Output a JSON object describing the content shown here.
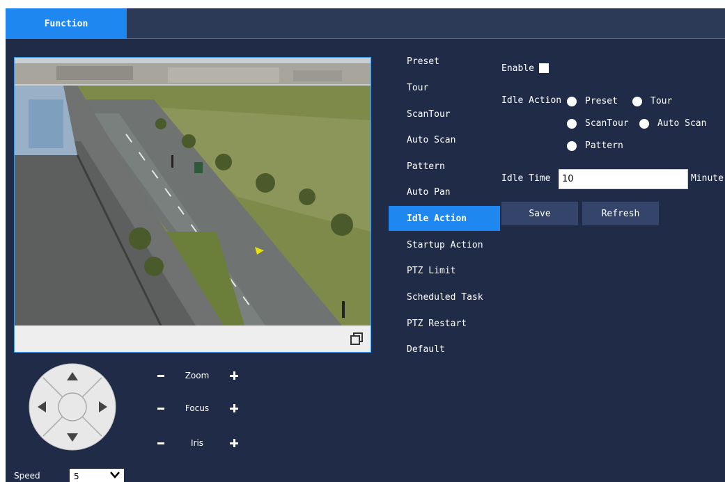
{
  "header": {
    "tab_function": "Function"
  },
  "ptz": {
    "zoom_label": "Zoom",
    "focus_label": "Focus",
    "iris_label": "Iris",
    "speed_label": "Speed",
    "speed_value": "5"
  },
  "menu": {
    "items": [
      {
        "label": "Preset"
      },
      {
        "label": "Tour"
      },
      {
        "label": "ScanTour"
      },
      {
        "label": "Auto Scan"
      },
      {
        "label": "Pattern"
      },
      {
        "label": "Auto Pan"
      },
      {
        "label": "Idle Action",
        "active": true
      },
      {
        "label": "Startup Action"
      },
      {
        "label": "PTZ Limit"
      },
      {
        "label": "Scheduled Task"
      },
      {
        "label": "PTZ Restart"
      },
      {
        "label": "Default"
      }
    ]
  },
  "settings": {
    "enable_label": "Enable",
    "idle_action_label": "Idle Action",
    "options": {
      "preset": "Preset",
      "tour": "Tour",
      "scantour": "ScanTour",
      "autoscan": "Auto Scan",
      "pattern": "Pattern"
    },
    "idle_time_label": "Idle Time",
    "idle_time_value": "10",
    "idle_time_unit": "Minute",
    "save_label": "Save",
    "refresh_label": "Refresh"
  },
  "colors": {
    "background": "#202b47",
    "topbar": "#2d3a57",
    "accent": "#1e88f0",
    "button": "#34446a"
  }
}
